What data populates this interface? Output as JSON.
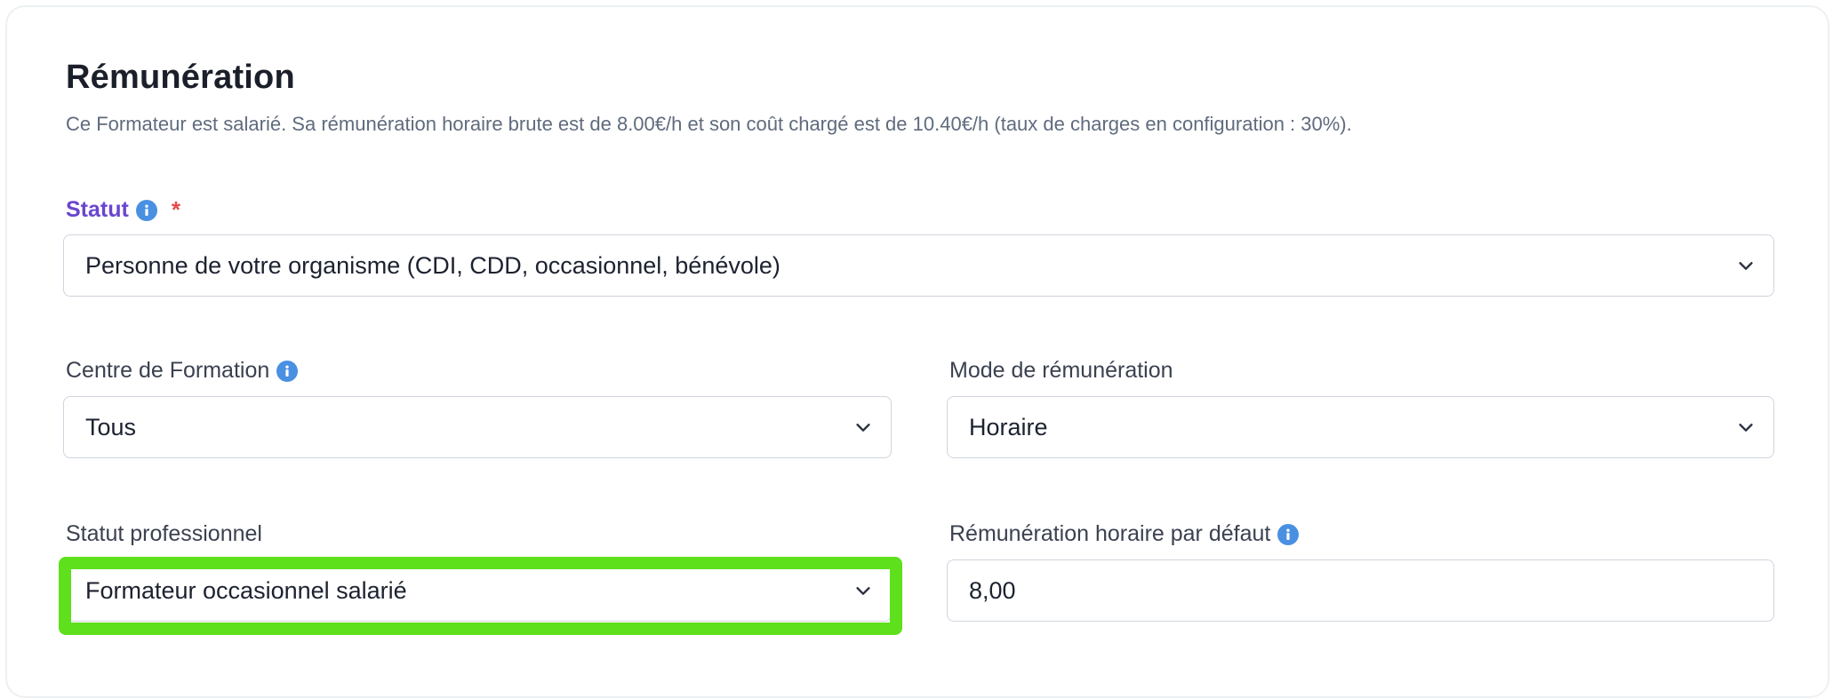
{
  "section": {
    "title": "Rémunération",
    "description": "Ce Formateur est salarié. Sa rémunération horaire brute est de 8.00€/h et son coût chargé est de 10.40€/h (taux de charges en configuration : 30%)."
  },
  "fields": {
    "statut": {
      "label": "Statut",
      "required_mark": "*",
      "value": "Personne de votre organisme (CDI, CDD, occasionnel, bénévole)"
    },
    "centre": {
      "label": "Centre de Formation",
      "value": "Tous"
    },
    "mode": {
      "label": "Mode de rémunération",
      "value": "Horaire"
    },
    "statut_pro": {
      "label": "Statut professionnel",
      "value": "Formateur occasionnel salarié"
    },
    "remuneration": {
      "label": "Rémunération horaire par défaut",
      "value": "8,00"
    }
  },
  "colors": {
    "accent_label": "#6a45d0",
    "required": "#e5484d",
    "info_icon": "#4a90e2",
    "highlight": "#5ee01c"
  }
}
